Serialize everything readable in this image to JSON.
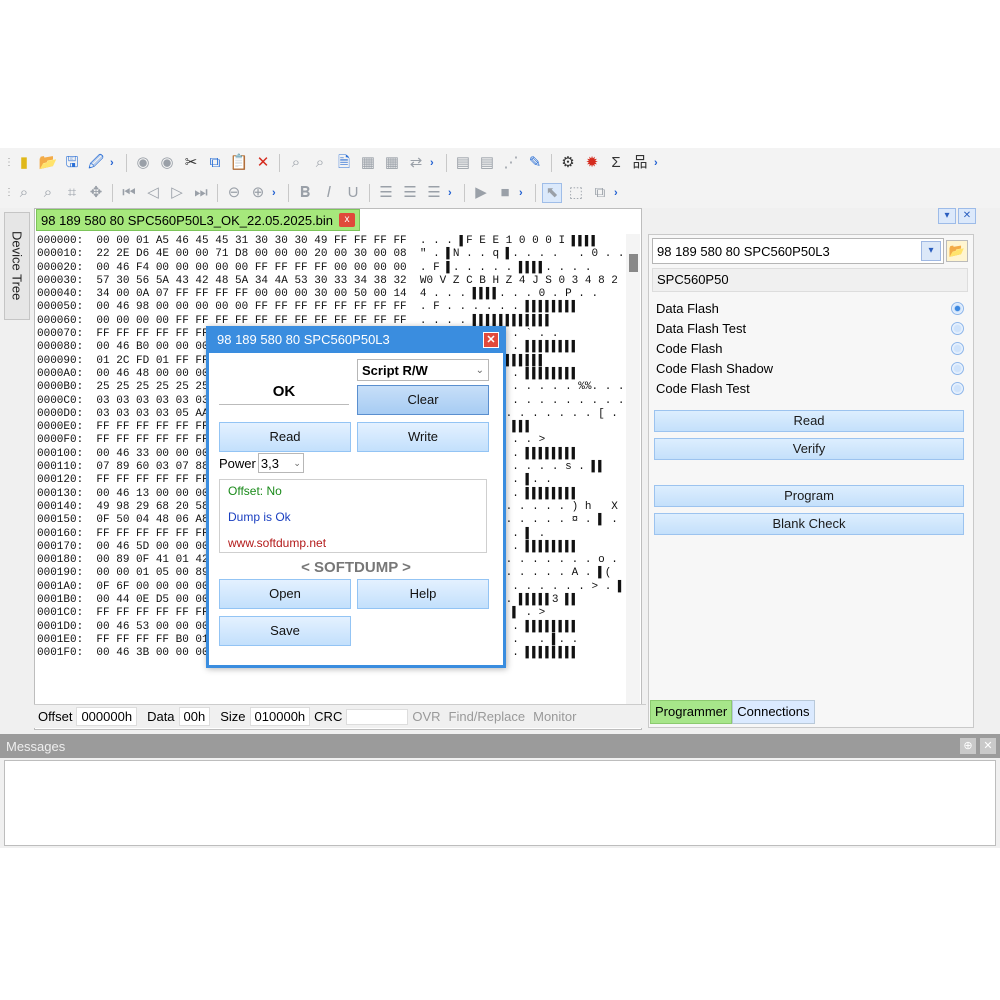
{
  "toolbar1": {
    "icons": [
      "chip-icon",
      "open-folder-icon",
      "save-icon",
      "save-as-icon",
      "more-icon",
      "refresh-icon",
      "refresh-all-icon",
      "cut-icon",
      "copy-icon",
      "paste-icon",
      "delete-icon",
      "find-icon",
      "find-replace-icon",
      "document-icon",
      "fill-icon",
      "fill2-icon",
      "swap-icon",
      "more-icon",
      "page-icon",
      "page2-icon",
      "grid-icon",
      "editor-icon",
      "settings-icon",
      "bug-icon",
      "sigma-icon",
      "tree-icon",
      "more-icon"
    ]
  },
  "sidetab": {
    "label": "Device Tree"
  },
  "file_tab": {
    "label": "98 189 580 80 SPC560P50L3_OK_22.05.2025.bin",
    "close": "x"
  },
  "hex_lines": [
    "000000:  00 00 01 A5 46 45 45 31 30 30 30 49 FF FF FF FF  . . . ▌F E E 1 0 0 0 I ▌▌▌▌",
    "000010:  22 2E D6 4E 00 00 71 D8 00 00 00 20 00 30 00 08  \" . ▌N . . q ▌. . . .   . 0 . .",
    "000020:  00 46 F4 00 00 00 00 00 FF FF FF FF 00 00 00 00  . F ▌. . . . . ▌▌▌▌. . . .",
    "000030:  57 30 56 5A 43 42 48 5A 34 4A 53 30 33 34 38 32  W0 V Z C B H Z 4 J S 0 3 4 8 2",
    "000040:  34 00 0A 07 FF FF FF FF 00 00 00 30 00 50 00 14  4 . . . ▌▌▌▌. . . 0 . P . .",
    "000050:  00 46 98 00 00 00 00 00 FF FF FF FF FF FF FF FF  . F . . . . . . ▌▌▌▌▌▌▌▌",
    "000060:  00 00 00 00 FF FF FF FF FF FF FF FF FF FF FF FF  . . . . ▌▌▌▌▌▌▌▌▌▌▌▌",
    "000070:  FF FF FF FF FF FF FF FF FF FF FF FF 30 00 60 00  ▌▌▌▌▌▌▌▌▌▌▌▌0 . ` . .",
    "000080:  00 46 B0 00 00 00 00 00 FF FF FF FF FF FF FF FF  . F . . . . . . ▌▌▌▌▌▌▌▌",
    "000090:  01 2C FD 01 FF FF FF FF FF FF FF FF FF FF FF FF  . , ▌. ▌▌▌▌▌▌▌▌▌▌▌▌",
    "0000A0:  00 46 48 00 00 00 00 00 FF FF FF FF FF FF FF FF  . F H . . . . . ▌▌▌▌▌▌▌▌",
    "0000B0:  25 25 25 25 25 25 1A 00 00 00 00 00 25 25 00 00  % % % % % % . . . . . . %%. . .",
    "0000C0:  03 03 03 03 03 03 03 03 03 03 03 03 03 03 03 03  . . . . . . . . . . . . . . . .",
    "0000D0:  03 03 03 03 05 AA 00 00 00 00 00 00 00 00 5B 00  . . . . . ▌. . . . . . . . [ .",
    "0000E0:  FF FF FF FF FF FF FF FF FF FF FF FF 00 FF FF FF  ▌▌▌▌▌▌▌▌▌▌▌▌. ▌▌▌",
    "0000F0:  FF FF FF FF FF FF FF FF FF FF FF FF 60 00 00 3E  ▌▌▌▌▌▌▌▌▌▌▌▌` . . >",
    "000100:  00 46 33 00 00 00 00 00 FF FF FF FF FF FF FF FF  . F 3 . . . . . ▌▌▌▌▌▌▌▌",
    "000110:  07 89 60 03 07 88 6B 00 00 00 00 00 73 00 FF FF  . ▌` . . ▌k . . . . . s . ▌▌",
    "000120:  FF FF FF FF FF FF FF FF FF FF FF FF 30 00 FF FF  ▌▌▌▌▌▌▌▌▌▌▌▌0 . ▌. .",
    "000130:  00 46 13 00 00 00 00 00 FF FF FF FF FF FF FF FF  . F . . . . . . ▌▌▌▌▌▌▌▌",
    "000140:  49 98 29 68 20 58 00 00 00 00 00 00 29 68 20 58  I ▌) h   X . . . . . . ) h   X",
    "000150:  0F 50 04 48 06 A8 00 00 00 00 00 00 A4 00 FF 00  . P . H . ▌. . . . . . ¤ . ▌ .",
    "000160:  FF FF FF FF FF FF FF FF FF FF FF FF 40 00 FF 00  ▌▌▌▌▌▌▌▌▌▌▌▌@ . ▌ .",
    "000170:  00 46 5D 00 00 00 00 00 FF FF FF FF FF FF FF FF  . F ] . . . . . ▌▌▌▌▌▌▌▌",
    "000180:  00 89 0F 41 01 42 00 00 00 00 00 00 00 00 6F 00  . ▌. A . B . . . . . . . . o .",
    "000190:  00 00 01 05 00 89 00 00 00 00 00 00 41 00 FF 28  . . . . . ▌. . . . . . A . ▌(",
    "0001A0:  0F 6F 00 00 00 00 00 00 00 00 00 00 00 3E 00 FF  . o . . . . . . . . . . . > . ▌",
    "0001B0:  00 44 0E D5 00 00 00 00 FF FF FF FF FF 33 FF FF  . D . ▌. . . . ▌▌▌▌▌3 ▌▌",
    "0001C0:  FF FF FF FF FF FF FF FF FF FF FF FF 00 FF 00 3E  ▌▌▌▌▌▌▌▌▌▌▌▌. ▌ . >",
    "0001D0:  00 46 53 00 00 00 00 00 FF FF FF FF FF FF FF FF  . F S . . . . . ▌▌▌▌▌▌▌▌",
    "0001E0:  FF FF FF FF B0 01 FF FF 00 00 00 20 01 F0 00 06  ▌▌▌▌° . ▌▌. . .   . ▌. .",
    "0001F0:  00 46 3B 00 00 00 00 00 FF FF FF FF FF FF FF FF  . F ; . . . . . ▌▌▌▌▌▌▌▌"
  ],
  "status": {
    "offset_label": "Offset",
    "offset_value": "000000h",
    "data_label": "Data",
    "data_value": "00h",
    "size_label": "Size",
    "size_value": "010000h",
    "crc_label": "CRC",
    "ovr": "OVR",
    "find": "Find/Replace",
    "monitor": "Monitor"
  },
  "right_panel": {
    "device_combo": "98 189 580 80 SPC560P50L3",
    "chip": "SPC560P50",
    "modes": [
      {
        "label": "Data Flash",
        "selected": true
      },
      {
        "label": "Data Flash Test",
        "selected": false
      },
      {
        "label": "Code Flash",
        "selected": false
      },
      {
        "label": "Code Flash Shadow",
        "selected": false
      },
      {
        "label": "Code Flash Test",
        "selected": false
      }
    ],
    "read": "Read",
    "verify": "Verify",
    "program": "Program",
    "blank_check": "Blank Check"
  },
  "bottom_tabs": {
    "programmer": "Programmer",
    "connections": "Connections"
  },
  "messages": {
    "title": "Messages"
  },
  "dialog": {
    "title": "98 189 580 80 SPC560P50L3",
    "script_select": "Script R/W",
    "status": "OK",
    "clear": "Clear",
    "read": "Read",
    "write": "Write",
    "power_label": "Power",
    "power_value": "3,3",
    "log": {
      "offset": "Offset: No",
      "dump": "Dump is Ok",
      "site": "www.softdump.net"
    },
    "brand": "< SOFTDUMP >",
    "open": "Open",
    "help": "Help",
    "save": "Save"
  },
  "colors": {
    "tab_green": "#a6e87c",
    "dialog_blue": "#3a8ddf",
    "button_blue": "#c4e0fb",
    "log_green": "#1a8a1a",
    "log_blue": "#1a3fc0",
    "log_red": "#b31a1a"
  }
}
